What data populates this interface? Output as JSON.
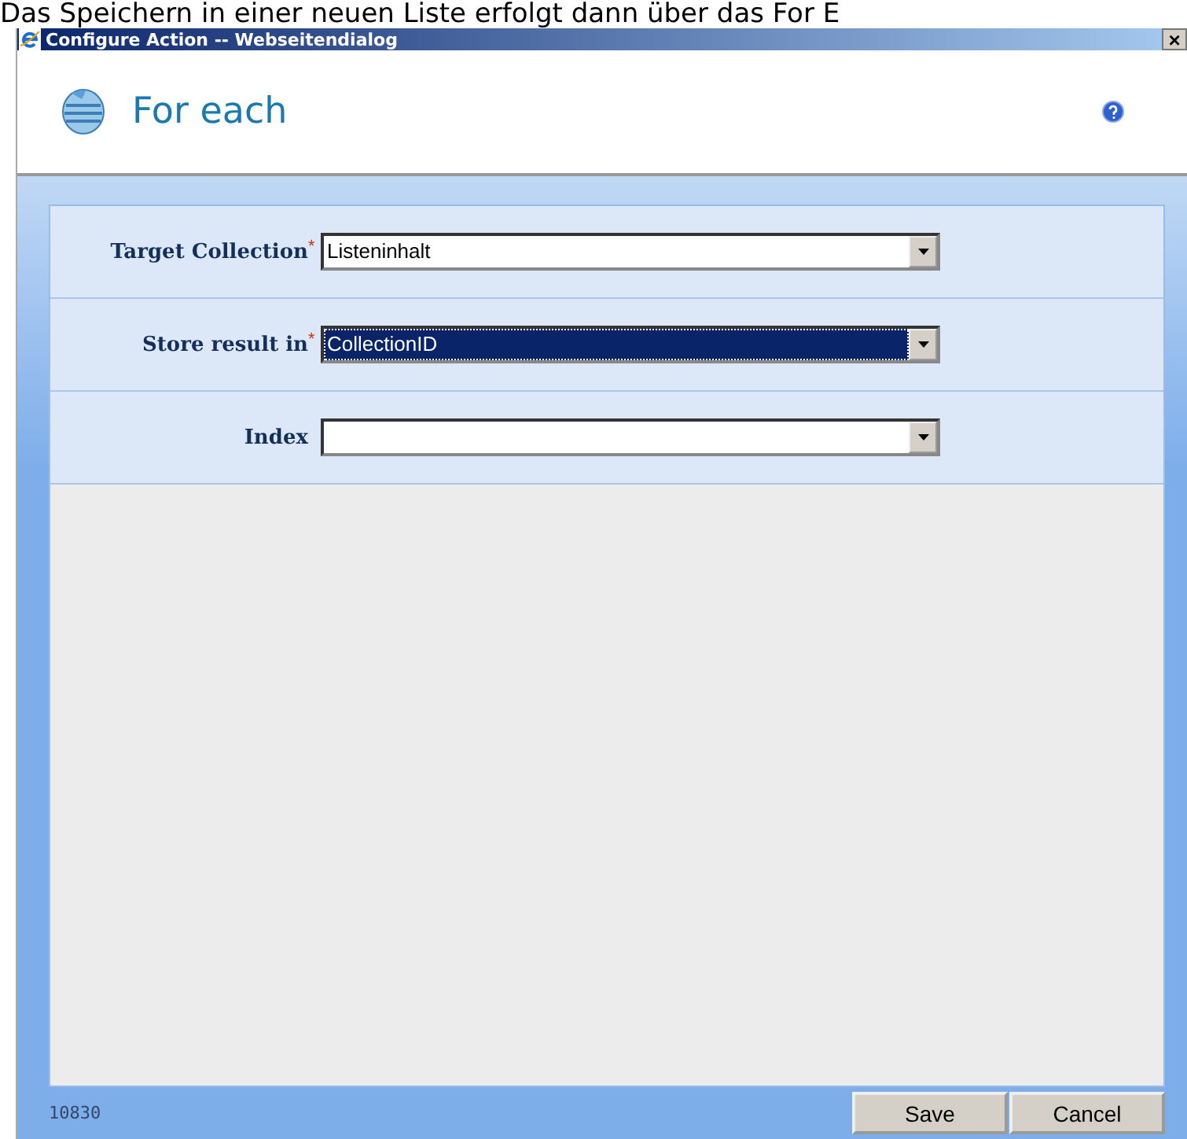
{
  "background_text": "Das Speichern in einer neuen Liste erfolgt dann über das For E",
  "window": {
    "title": "Configure Action -- Webseitendialog",
    "close": "×"
  },
  "header": {
    "title": "For each"
  },
  "fields": [
    {
      "label": "Target Collection",
      "required": true,
      "value": "Listeninhalt",
      "focused": false
    },
    {
      "label": "Store result in",
      "required": true,
      "value": "CollectionID",
      "focused": true
    },
    {
      "label": "Index",
      "required": false,
      "focused": false
    }
  ],
  "required_mark": "*",
  "footer": {
    "code": "10830",
    "buttons": [
      "Save",
      "Cancel"
    ]
  }
}
